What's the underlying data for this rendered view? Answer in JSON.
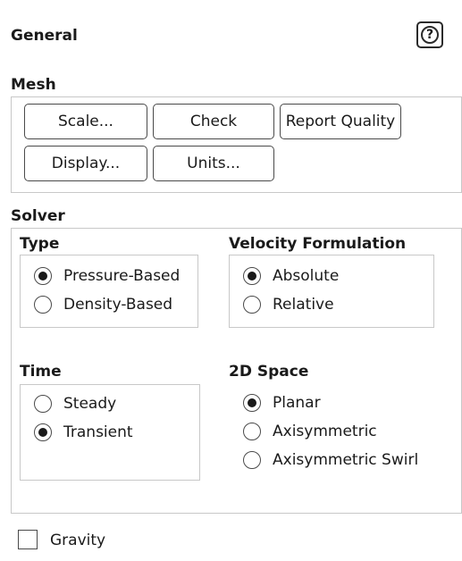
{
  "panel": {
    "title": "General",
    "help_icon": "question-circle-icon"
  },
  "mesh": {
    "label": "Mesh",
    "buttons": {
      "scale": "Scale...",
      "check": "Check",
      "report_quality": "Report Quality",
      "display": "Display...",
      "units": "Units..."
    }
  },
  "solver": {
    "label": "Solver",
    "type": {
      "label": "Type",
      "options": [
        "Pressure-Based",
        "Density-Based"
      ],
      "selected": "Pressure-Based"
    },
    "velocity_formulation": {
      "label": "Velocity Formulation",
      "options": [
        "Absolute",
        "Relative"
      ],
      "selected": "Absolute"
    },
    "time": {
      "label": "Time",
      "options": [
        "Steady",
        "Transient"
      ],
      "selected": "Transient"
    },
    "space_2d": {
      "label": "2D Space",
      "options": [
        "Planar",
        "Axisymmetric",
        "Axisymmetric Swirl"
      ],
      "selected": "Planar"
    }
  },
  "gravity": {
    "label": "Gravity",
    "checked": false
  }
}
